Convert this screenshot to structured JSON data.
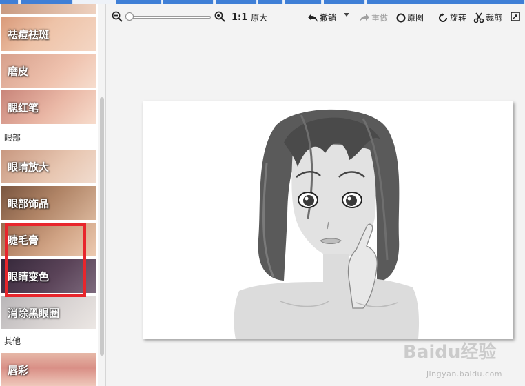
{
  "sidebar": {
    "tiles_top": [
      {
        "label": ""
      },
      {
        "label": "祛痘祛斑"
      },
      {
        "label": "磨皮"
      },
      {
        "label": "腮红笔"
      }
    ],
    "section_eyes": "眼部",
    "tiles_eyes": [
      {
        "label": "眼睛放大"
      },
      {
        "label": "眼部饰品"
      },
      {
        "label": "睫毛膏"
      },
      {
        "label": "眼睛变色"
      },
      {
        "label": "消除黑眼圈"
      }
    ],
    "section_other": "其他",
    "tiles_other": [
      {
        "label": "唇彩"
      }
    ]
  },
  "toolbar": {
    "ratio_label": "1:1",
    "original_size_label": "原大",
    "undo_label": "撤销",
    "redo_label": "重做",
    "original_image_label": "原图",
    "rotate_label": "旋转",
    "crop_label": "裁剪",
    "zoom_level": 0
  },
  "watermark": {
    "brand": "Baidu经验",
    "url": "jingyan.baidu.com"
  },
  "colors": {
    "accent_blue": "#3f7fd6",
    "highlight_red": "#e8262c"
  }
}
